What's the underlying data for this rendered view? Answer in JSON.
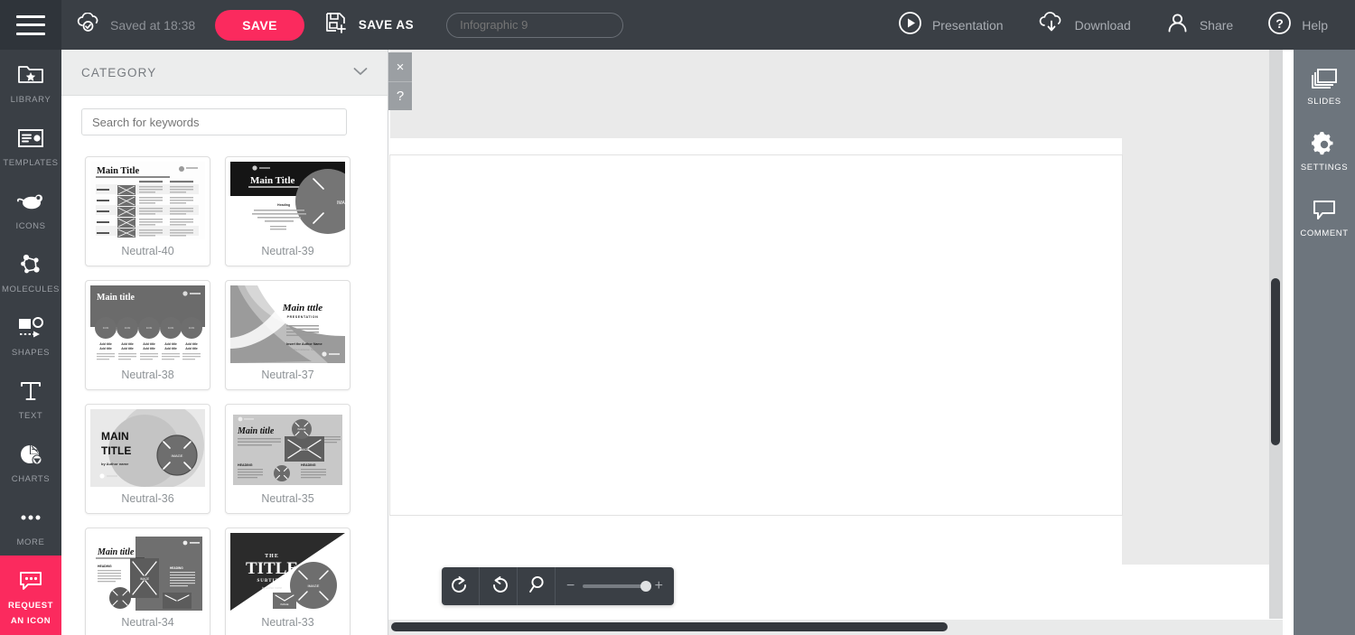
{
  "topbar": {
    "menu_icon": "hamburger-icon",
    "cloud_icon": "cloud-check-icon",
    "saved_text": "Saved at 18:38",
    "save_label": "SAVE",
    "saveas_icon": "save-as-floppy-icon",
    "saveas_label": "SAVE AS",
    "title_value": "Infographic 9",
    "title_placeholder": "Infographic 9",
    "actions": [
      {
        "label": "Presentation",
        "icon": "play-circle-icon"
      },
      {
        "label": "Download",
        "icon": "cloud-download-icon"
      },
      {
        "label": "Share",
        "icon": "person-icon"
      },
      {
        "label": "Help",
        "icon": "question-circle-icon"
      }
    ],
    "accent_color": "#fb2a5e",
    "bar_color": "#3a3f45"
  },
  "left_rail": {
    "items": [
      {
        "label": "LIBRARY",
        "icon": "folder-star-icon"
      },
      {
        "label": "TEMPLATES",
        "icon": "layout-card-icon"
      },
      {
        "label": "ICONS",
        "icon": "mouse-animal-icon"
      },
      {
        "label": "MOLECULES",
        "icon": "molecule-icon"
      },
      {
        "label": "SHAPES",
        "icon": "shapes-icon"
      },
      {
        "label": "TEXT",
        "icon": "text-t-icon"
      },
      {
        "label": "CHARTS",
        "icon": "pie-chart-icon"
      },
      {
        "label": "MORE",
        "icon": "ellipsis-icon"
      }
    ],
    "request": {
      "label_line1": "REQUEST",
      "label_line2": "AN ICON",
      "icon": "chat-bubble-ellipsis-icon"
    }
  },
  "panel": {
    "header_label": "CATEGORY",
    "header_icon": "chevron-down-icon",
    "search_placeholder": "Search for keywords",
    "search_value": "",
    "close_label": "×",
    "help_label": "?",
    "templates": [
      {
        "name": "Neutral-40",
        "style": "table-list"
      },
      {
        "name": "Neutral-39",
        "style": "dark-banner-circle"
      },
      {
        "name": "Neutral-38",
        "style": "gray-header-circles"
      },
      {
        "name": "Neutral-37",
        "style": "curved-script"
      },
      {
        "name": "Neutral-36",
        "style": "big-title-circle"
      },
      {
        "name": "Neutral-35",
        "style": "gray-full-image"
      },
      {
        "name": "Neutral-34",
        "style": "main-title-blocks"
      },
      {
        "name": "Neutral-33",
        "style": "diagonal-title"
      }
    ]
  },
  "canvas": {
    "slide_background": "#ffffff",
    "workspace_background": "#eaeaea"
  },
  "toolbar": {
    "buttons": [
      {
        "name": "redo-button",
        "icon": "redo-arrow-icon"
      },
      {
        "name": "undo-button",
        "icon": "undo-arrow-icon"
      },
      {
        "name": "zoom-fit-button",
        "icon": "magnifier-icon"
      }
    ],
    "zoom_minus": "−",
    "zoom_plus": "+",
    "zoom_value": 60
  },
  "right_rail": {
    "items": [
      {
        "label": "SLIDES",
        "icon": "slides-stack-icon"
      },
      {
        "label": "SETTINGS",
        "icon": "gear-icon"
      },
      {
        "label": "COMMENT",
        "icon": "comment-bubble-icon"
      }
    ]
  }
}
